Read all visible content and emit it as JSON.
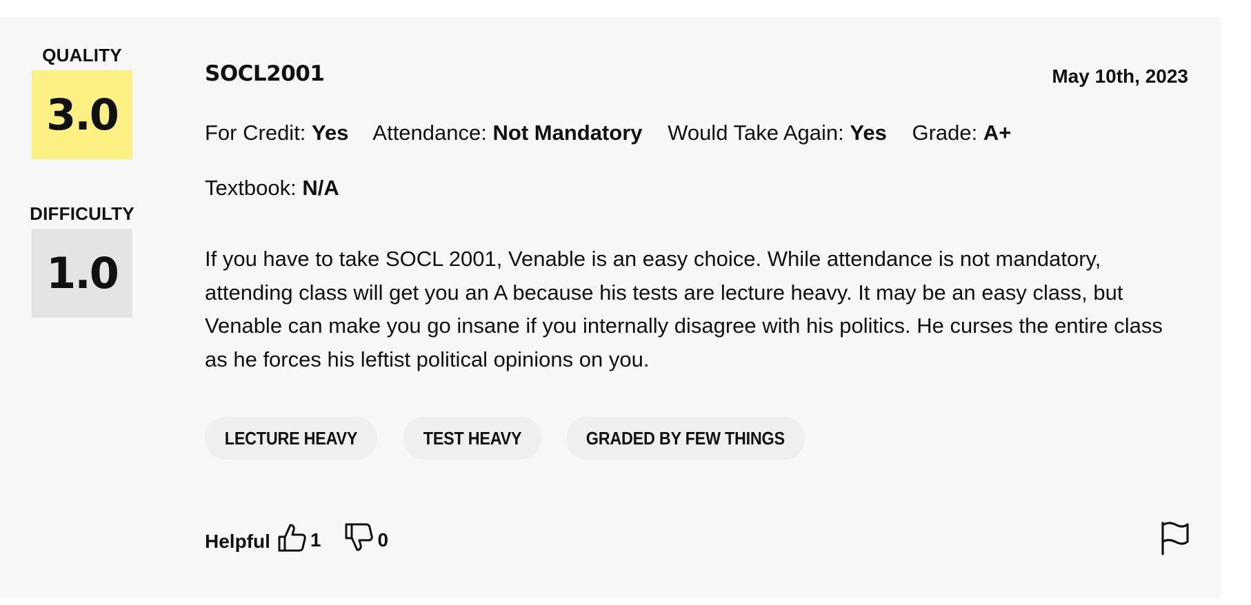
{
  "ratings": {
    "quality_label": "QUALITY",
    "quality_value": "3.0",
    "difficulty_label": "DIFFICULTY",
    "difficulty_value": "1.0"
  },
  "review": {
    "course": "SOCL2001",
    "date": "May 10th, 2023",
    "for_credit_label": "For Credit:",
    "for_credit_value": "Yes",
    "attendance_label": "Attendance:",
    "attendance_value": "Not Mandatory",
    "take_again_label": "Would Take Again:",
    "take_again_value": "Yes",
    "grade_label": "Grade:",
    "grade_value": "A+",
    "textbook_label": "Textbook:",
    "textbook_value": "N/A",
    "comment": "If you have to take SOCL 2001, Venable is an easy choice. While attendance is not mandatory, attending class will get you an A because his tests are lecture heavy. It may be an easy class, but Venable can make you go insane if you internally disagree with his politics. He curses the entire class as he forces his leftist political opinions on you.",
    "tags": [
      "LECTURE HEAVY",
      "TEST HEAVY",
      "GRADED BY FEW THINGS"
    ]
  },
  "feedback": {
    "helpful_label": "Helpful",
    "thumbs_up_count": "1",
    "thumbs_down_count": "0"
  },
  "colors": {
    "quality_box": "#fdf083",
    "difficulty_box": "#e4e4e4",
    "card_background": "#f7f7f7",
    "tag_background": "#efefef"
  },
  "icons": {
    "thumbs_up": "thumbs-up-icon",
    "thumbs_down": "thumbs-down-icon",
    "flag": "flag-icon"
  }
}
